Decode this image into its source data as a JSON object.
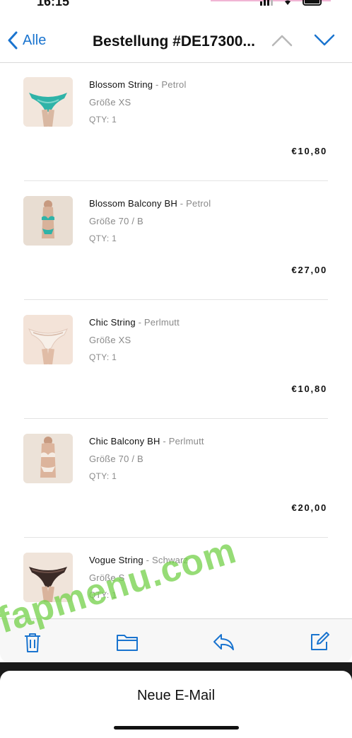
{
  "status_bar": {
    "time": "16:15"
  },
  "nav": {
    "back_label": "Alle",
    "title": "Bestellung #DE17300..."
  },
  "items": [
    {
      "name": "Blossom String",
      "variant": " - Petrol",
      "size": "Größe XS",
      "qty": "QTY: 1",
      "price": "€10,80",
      "thumb": "teal-string-photo"
    },
    {
      "name": "Blossom Balcony BH",
      "variant": " - Petrol",
      "size": "Größe 70 / B",
      "qty": "QTY: 1",
      "price": "€27,00",
      "thumb": "teal-set-photo"
    },
    {
      "name": "Chic String",
      "variant": " - Perlmutt",
      "size": "Größe XS",
      "qty": "QTY: 1",
      "price": "€10,80",
      "thumb": "pearl-string-photo"
    },
    {
      "name": "Chic Balcony BH",
      "variant": " - Perlmutt",
      "size": "Größe 70 / B",
      "qty": "QTY: 1",
      "price": "€20,00",
      "thumb": "pearl-set-photo"
    },
    {
      "name": "Vogue String",
      "variant": " - Schwarz",
      "size": "Größe S",
      "qty": "QTY: 1",
      "price": "",
      "thumb": "black-string-photo"
    }
  ],
  "toolbar": {
    "icons": [
      "trash-icon",
      "folder-icon",
      "reply-icon",
      "compose-icon"
    ]
  },
  "sheet": {
    "title": "Neue E-Mail"
  },
  "watermark": "fapmenu.com",
  "colors": {
    "accent": "#1a74cf",
    "secondary_text": "#8a8a8a",
    "watermark": "#78d250"
  }
}
